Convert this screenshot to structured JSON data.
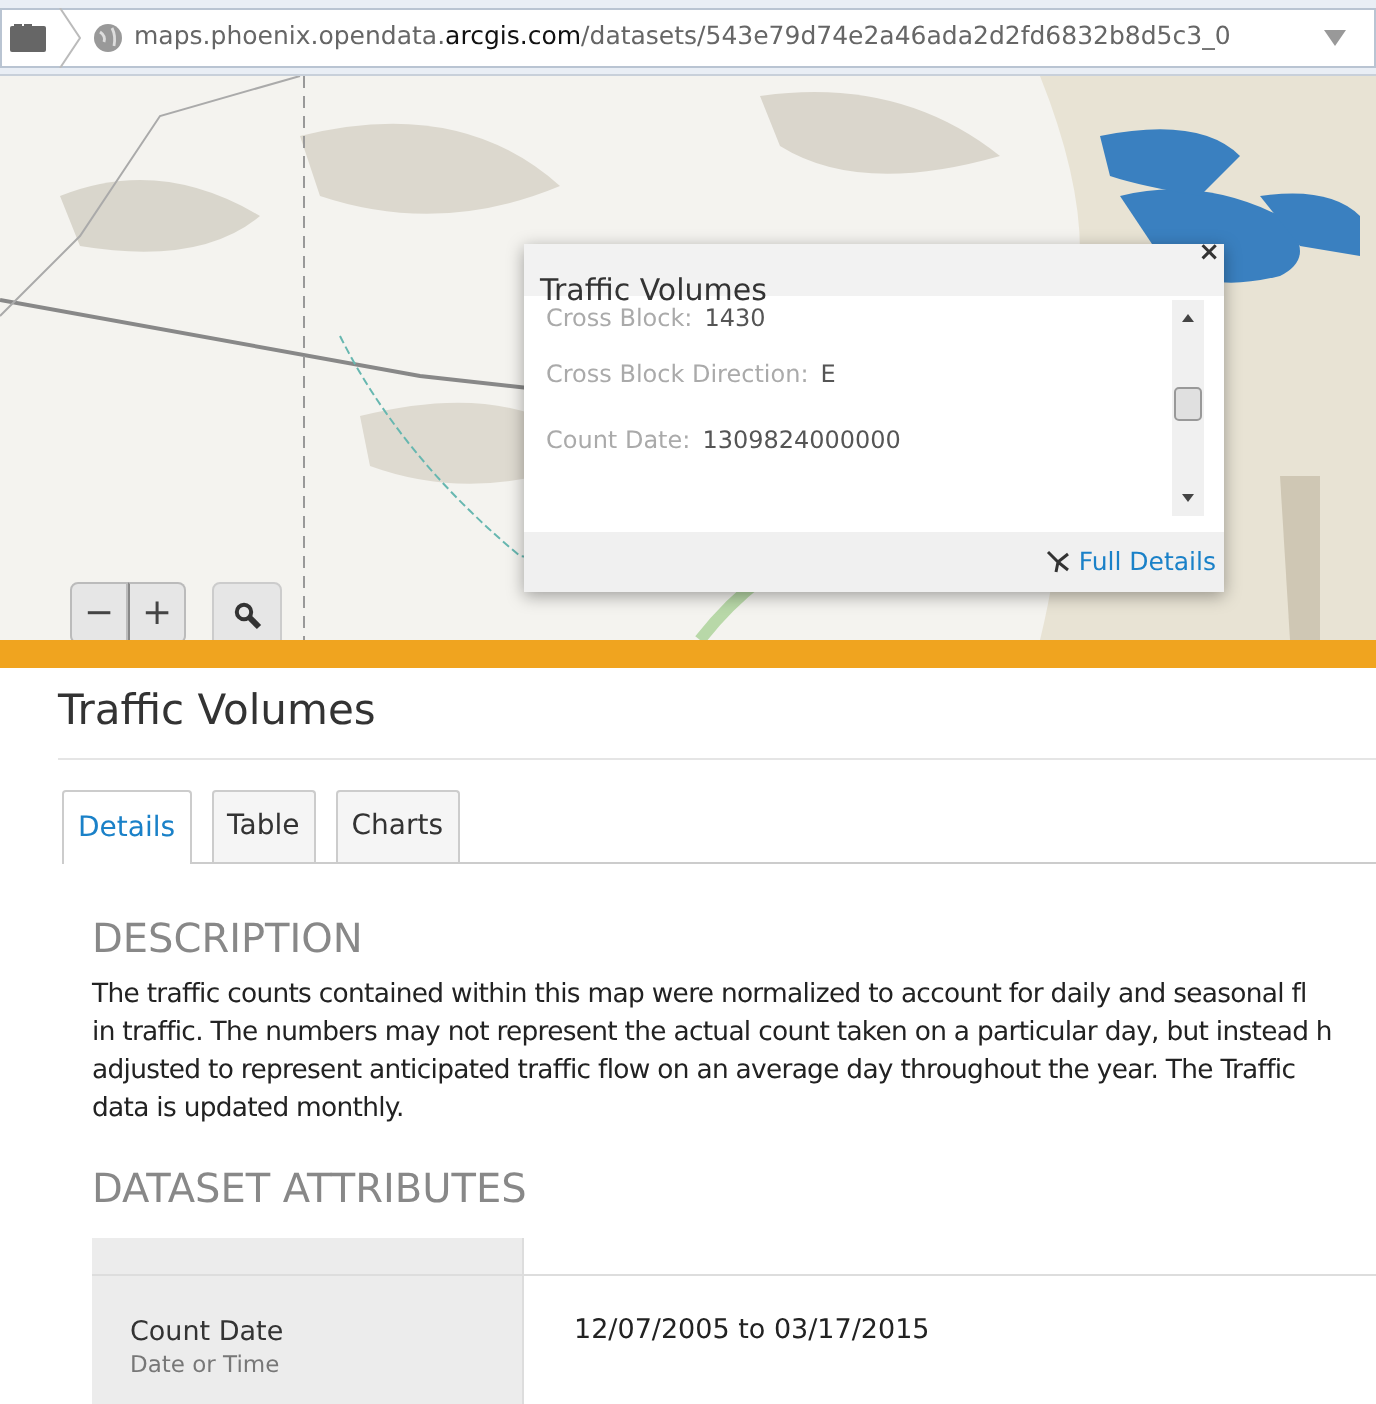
{
  "address_bar": {
    "url_prefix": "maps.phoenix.opendata.",
    "url_domain": "arcgis.com",
    "url_path": "/datasets/543e79d74e2a46ada2d2fd6832b8d5c3_0"
  },
  "map": {
    "kind": "picture",
    "zoom_out": "−",
    "zoom_in": "+"
  },
  "popup": {
    "title": "Traffic Volumes",
    "close": "×",
    "fields": [
      {
        "label": "Cross Block:",
        "value": "1430"
      },
      {
        "label": "Cross Block Direction:",
        "value": "E"
      },
      {
        "label": "Count Date:",
        "value": "1309824000000"
      }
    ],
    "link": "Full Details"
  },
  "page_title": "Traffic Volumes",
  "tabs": [
    {
      "label": "Details",
      "selected": true
    },
    {
      "label": "Table",
      "selected": false
    },
    {
      "label": "Charts",
      "selected": false
    }
  ],
  "description": {
    "heading": "DESCRIPTION",
    "lines": [
      "The traffic counts contained within this map were normalized to account for daily and seasonal fl",
      "in traffic. The numbers may not represent the actual count taken on a particular day, but instead h",
      "adjusted to represent anticipated traffic flow on an average day throughout the year. The Traffic",
      "data is updated monthly."
    ]
  },
  "attributes": {
    "heading": "DATASET ATTRIBUTES",
    "rows": [
      {
        "name": "Count Date",
        "type": "Date or Time",
        "value": "12/07/2005 to 03/17/2015"
      }
    ]
  }
}
